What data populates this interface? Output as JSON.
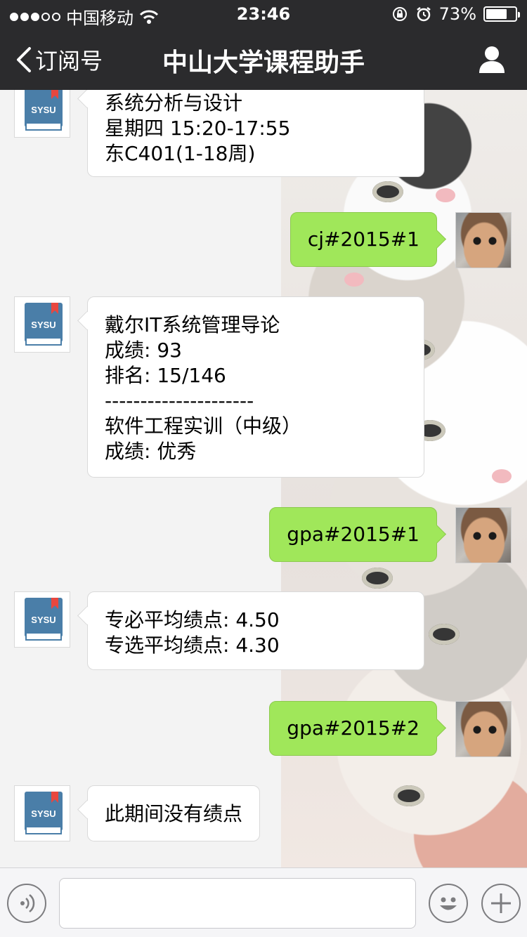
{
  "status_bar": {
    "carrier": "中国移动",
    "time": "23:46",
    "battery": "73%",
    "battery_level": 0.73,
    "signal_bars_filled": 3,
    "signal_bars_total": 5
  },
  "nav": {
    "back_label": "订阅号",
    "title": "中山大学课程助手"
  },
  "bot_avatar_text": "SYSU",
  "messages": [
    {
      "from": "bot",
      "lines": [
        "系统分析与设计",
        "星期四 15:20-17:55",
        "东C401(1-18周)"
      ]
    },
    {
      "from": "user",
      "text": "cj#2015#1"
    },
    {
      "from": "bot",
      "lines": [
        "戴尔IT系统管理导论",
        "成绩: 93",
        "排名: 15/146",
        "---------------------",
        "软件工程实训（中级）",
        "成绩: 优秀"
      ]
    },
    {
      "from": "user",
      "text": "gpa#2015#1"
    },
    {
      "from": "bot",
      "lines": [
        "专必平均绩点: 4.50",
        "专选平均绩点: 4.30"
      ]
    },
    {
      "from": "user",
      "text": "gpa#2015#2"
    },
    {
      "from": "bot",
      "lines": [
        "此期间没有绩点"
      ]
    }
  ],
  "input": {
    "placeholder": "",
    "value": ""
  },
  "colors": {
    "nav_bg": "#2b2b2d",
    "user_bubble": "#a0e75a",
    "bot_bubble": "#ffffff",
    "book_blue": "#4a7ea8",
    "bookmark_red": "#e8473f"
  },
  "icons": {
    "back": "chevron-left-icon",
    "profile": "person-icon",
    "voice": "voice-icon",
    "emoji": "emoji-icon",
    "more": "plus-icon"
  }
}
